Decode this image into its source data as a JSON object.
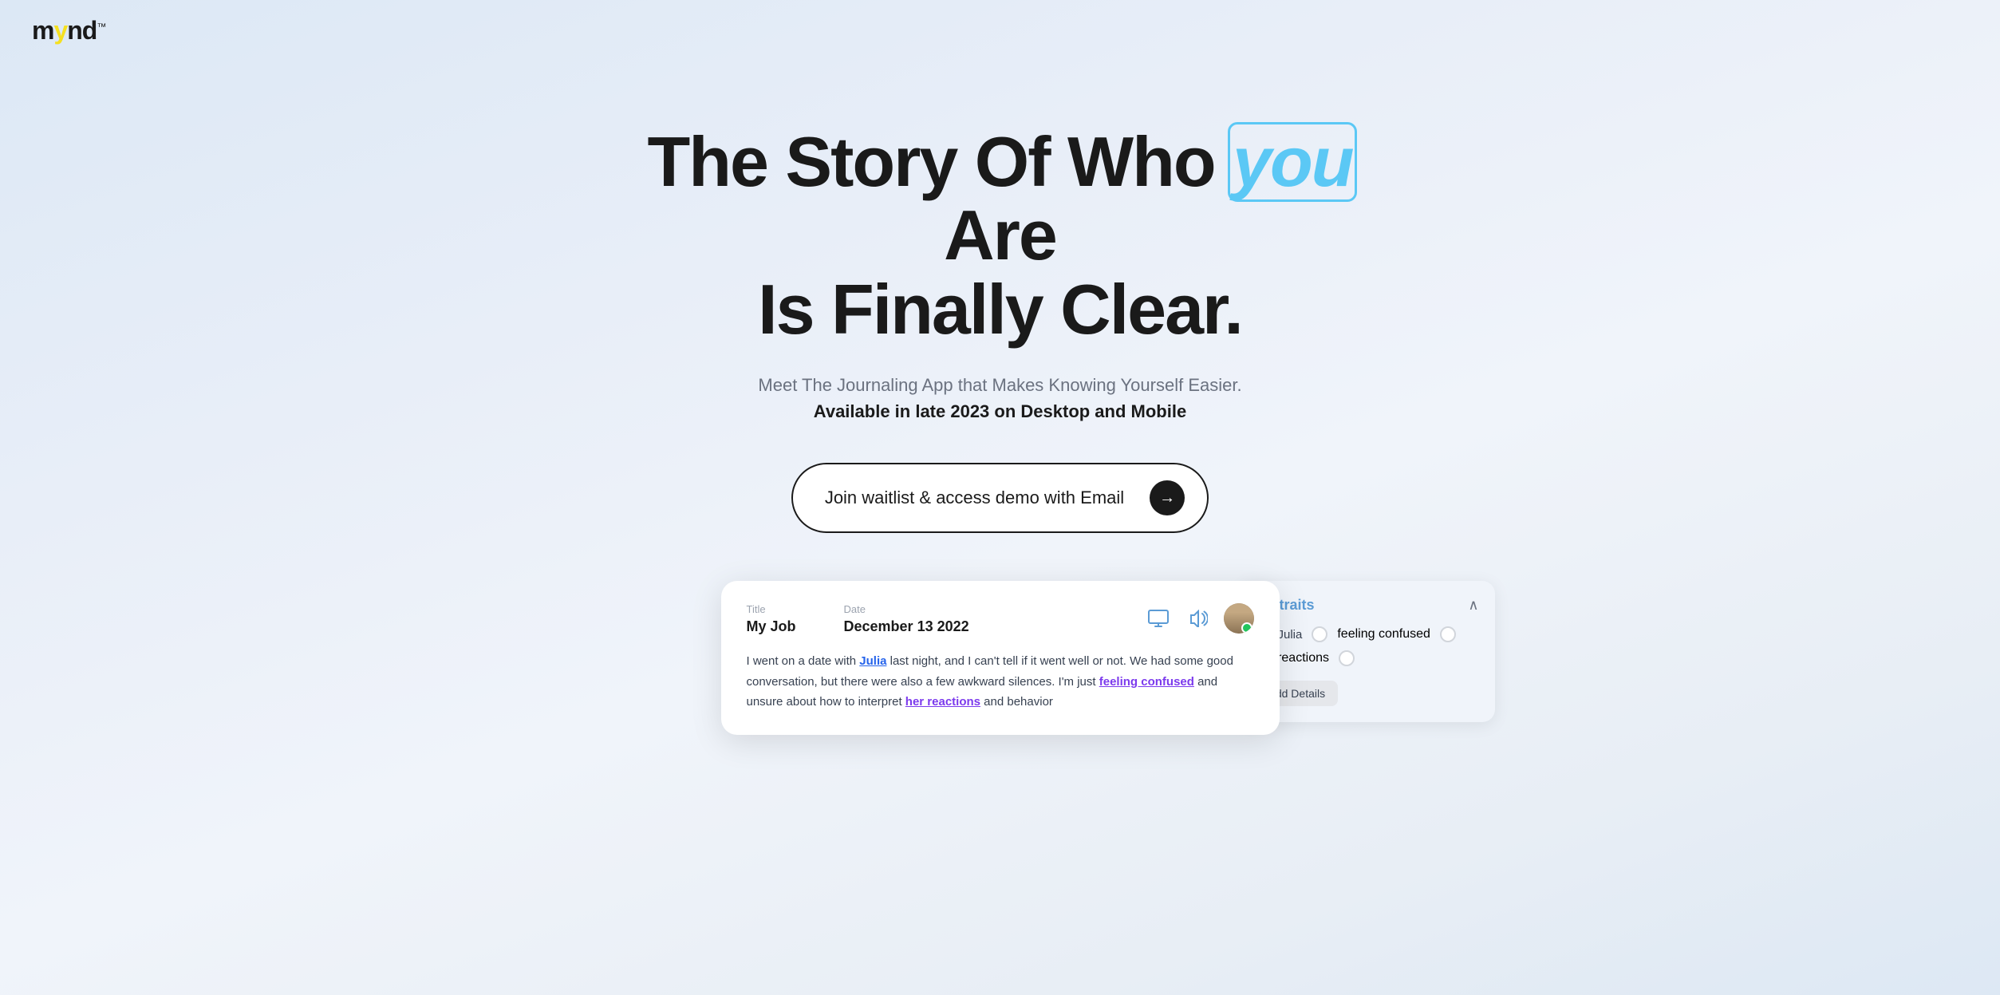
{
  "logo": {
    "text_before": "m",
    "text_y": "y",
    "text_after": "nd",
    "tm": "™"
  },
  "hero": {
    "title_part1": "The Story Of Who ",
    "title_you": "you",
    "title_part2": " Are",
    "title_line2": "Is Finally Clear.",
    "subtitle": "Meet The Journaling App that Makes Knowing Yourself Easier.",
    "subtitle_bold": "Available in late 2023 on Desktop and Mobile",
    "cta_label": "Join waitlist & access demo with Email",
    "cta_arrow": "→"
  },
  "app_preview": {
    "label_title": "Title",
    "value_title": "My Job",
    "label_date": "Date",
    "value_date": "December 13 2022",
    "body_text_pre": "I went on a date with ",
    "body_link1": "Julia",
    "body_text_mid1": " last night, and I can't tell if it went well or not. We had some good conversation, but there were also a few awkward silences. I'm just ",
    "body_link2": "feeling confused",
    "body_text_mid2": " and unsure about how to interpret ",
    "body_link3": "her reactions",
    "body_text_end": " and behavior"
  },
  "portraits": {
    "title": "Portraits",
    "item1_name": "Julia",
    "item1_tag": "feeling confused",
    "item1_tag2": "her reactions",
    "add_btn": "Add Details"
  },
  "icons": {
    "monitor": "🖥",
    "speaker": "🔊",
    "chevron_up": "∧"
  }
}
